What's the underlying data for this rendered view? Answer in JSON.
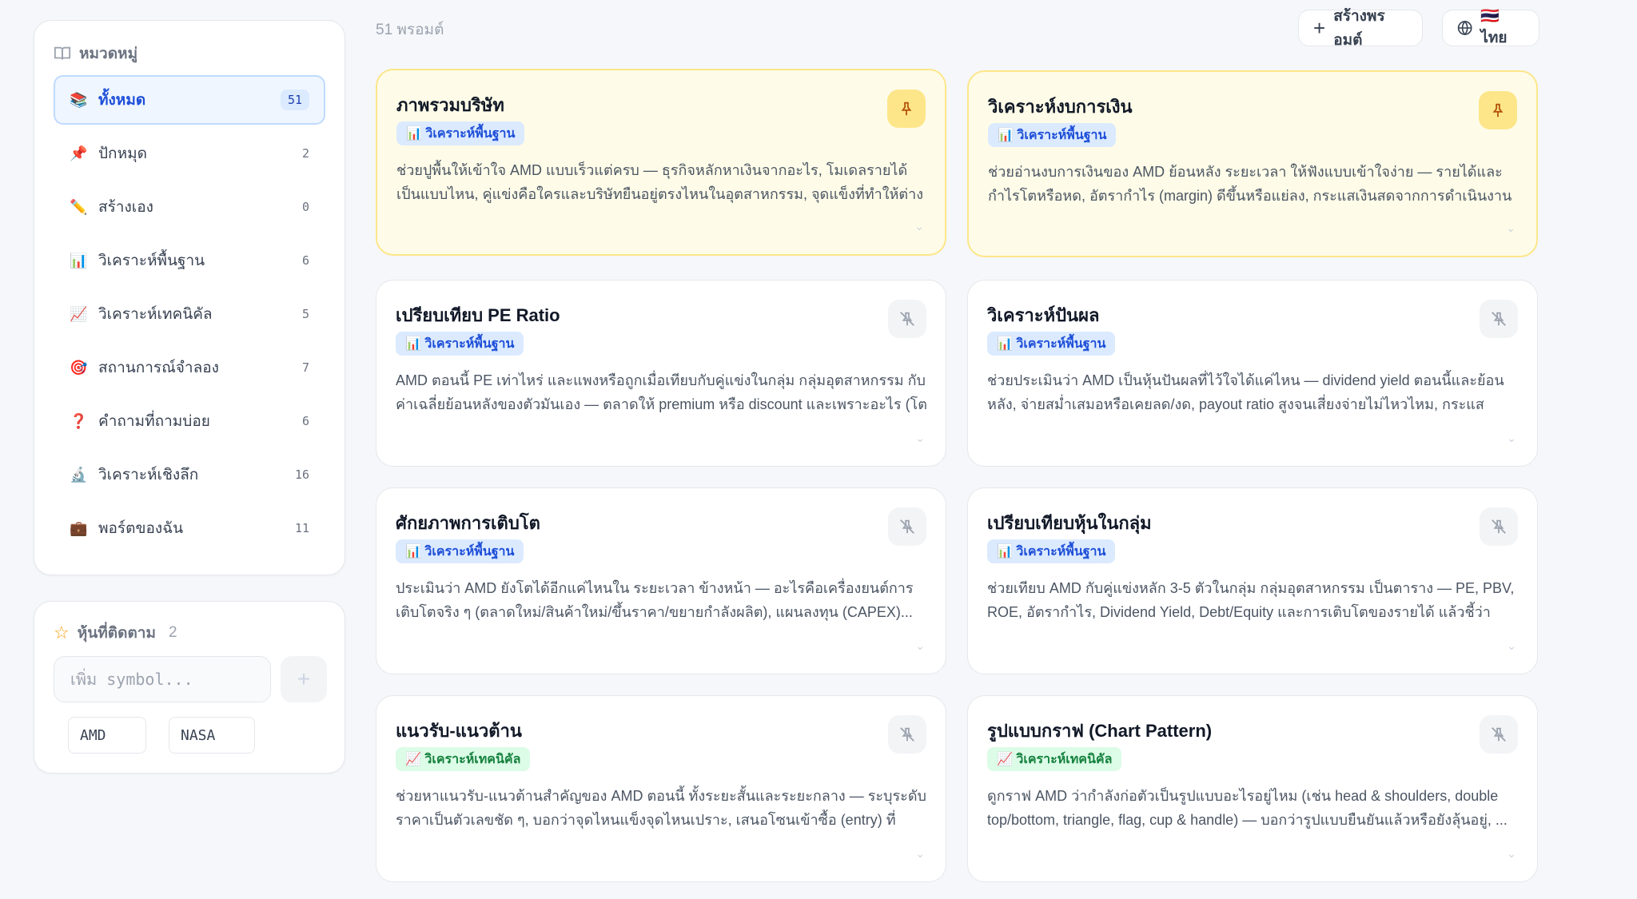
{
  "sidebar": {
    "title": "หมวดหมู่",
    "items": [
      {
        "icon": "📚",
        "label": "ทั้งหมด",
        "count": "51"
      },
      {
        "icon": "📌",
        "label": "ปักหมุด",
        "count": "2"
      },
      {
        "icon": "✏️",
        "label": "สร้างเอง",
        "count": "0"
      },
      {
        "icon": "📊",
        "label": "วิเคราะห์พื้นฐาน",
        "count": "6"
      },
      {
        "icon": "📈",
        "label": "วิเคราะห์เทคนิคัล",
        "count": "5"
      },
      {
        "icon": "🎯",
        "label": "สถานการณ์จำลอง",
        "count": "7"
      },
      {
        "icon": "❓",
        "label": "คำถามที่ถามบ่อย",
        "count": "6"
      },
      {
        "icon": "🔬",
        "label": "วิเคราะห์เชิงลึก",
        "count": "16"
      },
      {
        "icon": "💼",
        "label": "พอร์ตของฉัน",
        "count": "11"
      }
    ]
  },
  "watchlist": {
    "title": "หุ้นที่ติดตาม",
    "count": "2",
    "input_placeholder": "เพิ่ม symbol...",
    "add_label": "+",
    "symbols": [
      "AMD",
      "NASA"
    ]
  },
  "topbar": {
    "count_text": "51 พรอมต์",
    "create_label": "สร้างพรอมต์",
    "lang_label": "🇹🇭 ไทย"
  },
  "cards": [
    {
      "title": "ภาพรวมบริษัท",
      "tag": "📊 วิเคราะห์พื้นฐาน",
      "desc": "ช่วยปูพื้นให้เข้าใจ AMD แบบเร็วแต่ครบ — ธุรกิจหลักหาเงินจากอะไร, โมเดลรายได้เป็นแบบไหน, คู่แข่งคือใครและบริษัทยืนอยู่ตรงไหนในอุตสาหกรรม, จุดแข็งที่ทำให้ต่างจากคน..."
    },
    {
      "title": "วิเคราะห์งบการเงิน",
      "tag": "📊 วิเคราะห์พื้นฐาน",
      "desc": "ช่วยอ่านงบการเงินของ AMD ย้อนหลัง ระยะเวลา ให้ฟังแบบเข้าใจง่าย — รายได้และกำไรโตหรือหด, อัตรากำไร (margin) ดีขึ้นหรือแย่ลง, กระแสเงินสดจากการดำเนินงานแล..."
    },
    {
      "title": "เปรียบเทียบ PE Ratio",
      "tag": "📊 วิเคราะห์พื้นฐาน",
      "desc": "AMD ตอนนี้ PE เท่าไหร่ และแพงหรือถูกเมื่อเทียบกับคู่แข่งในกลุ่ม กลุ่มอุตสาหกรรม กับค่าเฉลี่ยย้อนหลังของตัวมันเอง — ตลาดให้ premium หรือ discount และเพราะอะไร (โตเร็ว..."
    },
    {
      "title": "วิเคราะห์ปันผล",
      "tag": "📊 วิเคราะห์พื้นฐาน",
      "desc": "ช่วยประเมินว่า AMD เป็นหุ้นปันผลที่ไว้ใจได้แค่ไหน — dividend yield ตอนนี้และย้อนหลัง, จ่ายสม่ำเสมอหรือเคยลด/งด, payout ratio สูงจนเสี่ยงจ่ายไม่ไหวไหม, กระแสเงินสดรอง..."
    },
    {
      "title": "ศักยภาพการเติบโต",
      "tag": "📊 วิเคราะห์พื้นฐาน",
      "desc": "ประเมินว่า AMD ยังโตได้อีกแค่ไหนใน ระยะเวลา ข้างหน้า — อะไรคือเครื่องยนต์การเติบโตจริง ๆ (ตลาดใหม่/สินค้าใหม่/ขึ้นราคา/ขยายกำลังผลิต), แผนลงทุน (CAPEX)..."
    },
    {
      "title": "เปรียบเทียบหุ้นในกลุ่ม",
      "tag": "📊 วิเคราะห์พื้นฐาน",
      "desc": "ช่วยเทียบ AMD กับคู่แข่งหลัก 3-5 ตัวในกลุ่ม กลุ่มอุตสาหกรรม เป็นตาราง — PE, PBV, ROE, อัตรากำไร, Dividend Yield, Debt/Equity และการเติบโตของรายได้ แล้วชี้ว่าใคร..."
    },
    {
      "title": "แนวรับ-แนวต้าน",
      "tag": "📈 วิเคราะห์เทคนิคัล",
      "desc": "ช่วยหาแนวรับ-แนวต้านสำคัญของ AMD ตอนนี้ ทั้งระยะสั้นและระยะกลาง — ระบุระดับราคาเป็นตัวเลขชัด ๆ, บอกว่าจุดไหนแข็งจุดไหนเปราะ, เสนอโซนเข้าซื้อ (entry) ที่ความ..."
    },
    {
      "title": "รูปแบบกราฟ (Chart Pattern)",
      "tag": "📈 วิเคราะห์เทคนิคัล",
      "desc": "ดูกราฟ AMD ว่ากำลังก่อตัวเป็นรูปแบบอะไรอยู่ไหม (เช่น head & shoulders, double top/bottom, triangle, flag, cup & handle) — บอกว่ารูปแบบยืนยันแล้วหรือยังลุ้นอยู่, ..."
    }
  ]
}
